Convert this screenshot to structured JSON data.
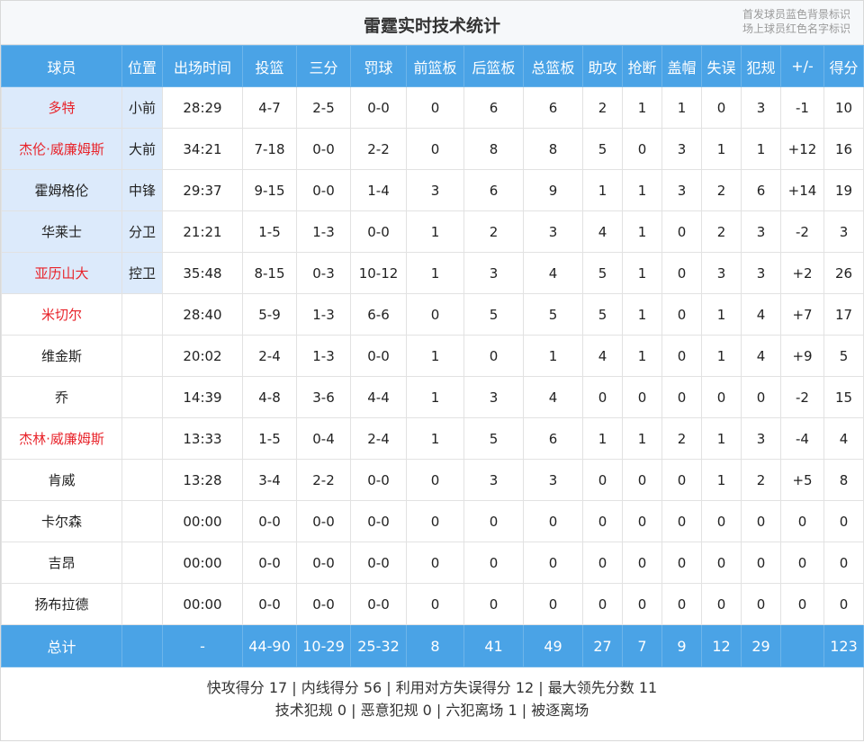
{
  "title": "雷霆实时技术统计",
  "legend": [
    "首发球员蓝色背景标识",
    "场上球员红色名字标识"
  ],
  "columns": [
    "球员",
    "位置",
    "出场时间",
    "投篮",
    "三分",
    "罚球",
    "前篮板",
    "后篮板",
    "总篮板",
    "助攻",
    "抢断",
    "盖帽",
    "失误",
    "犯规",
    "+/-",
    "得分"
  ],
  "colors": {
    "header_bg": "#4aa3e6",
    "starter_bg": "#dceafb",
    "oncourt_text": "#e8232a"
  },
  "players": [
    {
      "name": "多特",
      "pos": "小前",
      "min": "28:29",
      "fg": "4-7",
      "tp": "2-5",
      "ft": "0-0",
      "oreb": "0",
      "dreb": "6",
      "reb": "6",
      "ast": "2",
      "stl": "1",
      "blk": "1",
      "tov": "0",
      "pf": "3",
      "pm": "-1",
      "pts": "10",
      "starter": true,
      "oncourt": true
    },
    {
      "name": "杰伦·威廉姆斯",
      "pos": "大前",
      "min": "34:21",
      "fg": "7-18",
      "tp": "0-0",
      "ft": "2-2",
      "oreb": "0",
      "dreb": "8",
      "reb": "8",
      "ast": "5",
      "stl": "0",
      "blk": "3",
      "tov": "1",
      "pf": "1",
      "pm": "+12",
      "pts": "16",
      "starter": true,
      "oncourt": true
    },
    {
      "name": "霍姆格伦",
      "pos": "中锋",
      "min": "29:37",
      "fg": "9-15",
      "tp": "0-0",
      "ft": "1-4",
      "oreb": "3",
      "dreb": "6",
      "reb": "9",
      "ast": "1",
      "stl": "1",
      "blk": "3",
      "tov": "2",
      "pf": "6",
      "pm": "+14",
      "pts": "19",
      "starter": true,
      "oncourt": false
    },
    {
      "name": "华莱士",
      "pos": "分卫",
      "min": "21:21",
      "fg": "1-5",
      "tp": "1-3",
      "ft": "0-0",
      "oreb": "1",
      "dreb": "2",
      "reb": "3",
      "ast": "4",
      "stl": "1",
      "blk": "0",
      "tov": "2",
      "pf": "3",
      "pm": "-2",
      "pts": "3",
      "starter": true,
      "oncourt": false
    },
    {
      "name": "亚历山大",
      "pos": "控卫",
      "min": "35:48",
      "fg": "8-15",
      "tp": "0-3",
      "ft": "10-12",
      "oreb": "1",
      "dreb": "3",
      "reb": "4",
      "ast": "5",
      "stl": "1",
      "blk": "0",
      "tov": "3",
      "pf": "3",
      "pm": "+2",
      "pts": "26",
      "starter": true,
      "oncourt": true
    },
    {
      "name": "米切尔",
      "pos": "",
      "min": "28:40",
      "fg": "5-9",
      "tp": "1-3",
      "ft": "6-6",
      "oreb": "0",
      "dreb": "5",
      "reb": "5",
      "ast": "5",
      "stl": "1",
      "blk": "0",
      "tov": "1",
      "pf": "4",
      "pm": "+7",
      "pts": "17",
      "starter": false,
      "oncourt": true
    },
    {
      "name": "维金斯",
      "pos": "",
      "min": "20:02",
      "fg": "2-4",
      "tp": "1-3",
      "ft": "0-0",
      "oreb": "1",
      "dreb": "0",
      "reb": "1",
      "ast": "4",
      "stl": "1",
      "blk": "0",
      "tov": "1",
      "pf": "4",
      "pm": "+9",
      "pts": "5",
      "starter": false,
      "oncourt": false
    },
    {
      "name": "乔",
      "pos": "",
      "min": "14:39",
      "fg": "4-8",
      "tp": "3-6",
      "ft": "4-4",
      "oreb": "1",
      "dreb": "3",
      "reb": "4",
      "ast": "0",
      "stl": "0",
      "blk": "0",
      "tov": "0",
      "pf": "0",
      "pm": "-2",
      "pts": "15",
      "starter": false,
      "oncourt": false
    },
    {
      "name": "杰林·威廉姆斯",
      "pos": "",
      "min": "13:33",
      "fg": "1-5",
      "tp": "0-4",
      "ft": "2-4",
      "oreb": "1",
      "dreb": "5",
      "reb": "6",
      "ast": "1",
      "stl": "1",
      "blk": "2",
      "tov": "1",
      "pf": "3",
      "pm": "-4",
      "pts": "4",
      "starter": false,
      "oncourt": true
    },
    {
      "name": "肯威",
      "pos": "",
      "min": "13:28",
      "fg": "3-4",
      "tp": "2-2",
      "ft": "0-0",
      "oreb": "0",
      "dreb": "3",
      "reb": "3",
      "ast": "0",
      "stl": "0",
      "blk": "0",
      "tov": "1",
      "pf": "2",
      "pm": "+5",
      "pts": "8",
      "starter": false,
      "oncourt": false
    },
    {
      "name": "卡尔森",
      "pos": "",
      "min": "00:00",
      "fg": "0-0",
      "tp": "0-0",
      "ft": "0-0",
      "oreb": "0",
      "dreb": "0",
      "reb": "0",
      "ast": "0",
      "stl": "0",
      "blk": "0",
      "tov": "0",
      "pf": "0",
      "pm": "0",
      "pts": "0",
      "starter": false,
      "oncourt": false
    },
    {
      "name": "吉昂",
      "pos": "",
      "min": "00:00",
      "fg": "0-0",
      "tp": "0-0",
      "ft": "0-0",
      "oreb": "0",
      "dreb": "0",
      "reb": "0",
      "ast": "0",
      "stl": "0",
      "blk": "0",
      "tov": "0",
      "pf": "0",
      "pm": "0",
      "pts": "0",
      "starter": false,
      "oncourt": false
    },
    {
      "name": "扬布拉德",
      "pos": "",
      "min": "00:00",
      "fg": "0-0",
      "tp": "0-0",
      "ft": "0-0",
      "oreb": "0",
      "dreb": "0",
      "reb": "0",
      "ast": "0",
      "stl": "0",
      "blk": "0",
      "tov": "0",
      "pf": "0",
      "pm": "0",
      "pts": "0",
      "starter": false,
      "oncourt": false
    }
  ],
  "totals": {
    "name": "总计",
    "pos": "",
    "min": "-",
    "fg": "44-90",
    "tp": "10-29",
    "ft": "25-32",
    "oreb": "8",
    "dreb": "41",
    "reb": "49",
    "ast": "27",
    "stl": "7",
    "blk": "9",
    "tov": "12",
    "pf": "29",
    "pm": "",
    "pts": "123"
  },
  "footer": {
    "line1": "快攻得分 17 | 内线得分 56 | 利用对方失误得分 12 | 最大领先分数 11",
    "line2": "技术犯规 0 | 恶意犯规 0 | 六犯离场 1 | 被逐离场"
  }
}
